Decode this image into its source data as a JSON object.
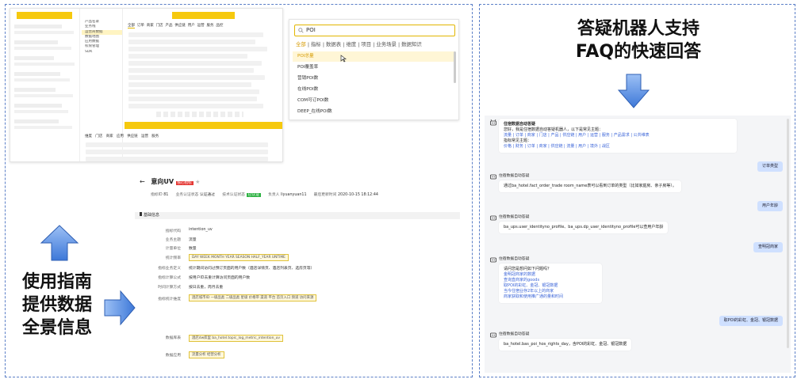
{
  "left_text": [
    "使用指南",
    "提供数据",
    "全景信息"
  ],
  "right_text": [
    "答疑机器人支持",
    "FAQ的快速回答"
  ],
  "nav_screenshot": {
    "tabs": [
      "全部",
      "订单",
      "商家",
      "门店",
      "产品",
      "供应链",
      "用户",
      "运营",
      "服务",
      "品控"
    ],
    "menu": [
      "产品名录",
      "业务线",
      "运营商数据",
      "数据地图",
      "应用数据",
      "权限管理",
      "SDK"
    ],
    "bottom_tabs": [
      "维度",
      "门店",
      "商家",
      "应用",
      "供应链",
      "运营",
      "服务"
    ]
  },
  "search_screenshot": {
    "query": "POI",
    "tabs": [
      "全部",
      "指标",
      "数据表",
      "维度",
      "项目",
      "业务场景",
      "数据知识"
    ],
    "results": [
      "POI总量",
      "POI覆盖率",
      "营销POI数",
      "在线POI数",
      "COM可订POI数",
      "DEEP_在线POI数"
    ]
  },
  "detail_screenshot": {
    "title": "意向UV",
    "badge": "核心指标",
    "meta": [
      {
        "label": "指标ID",
        "value": "81"
      },
      {
        "label": "业务认证状态",
        "value": "认证通过"
      },
      {
        "label": "技术认证状态",
        "value": "已认证"
      },
      {
        "label": "负责人",
        "value": "liyuanyuan11"
      },
      {
        "label": "最后更新时间",
        "value": "2020-10-15 18:12:44"
      }
    ],
    "section": "基础信息",
    "rows": [
      {
        "label": "指标代码",
        "value": "intention_uv"
      },
      {
        "label": "业务主题",
        "value": "流量"
      },
      {
        "label": "计量单位",
        "value": "数量"
      },
      {
        "label": "统计频率",
        "value": "DAY  WEEK  MONTH  YEAR  SEASON  HALF_YEAR  UNTIME"
      },
      {
        "label": "指标业务定义",
        "value": "统计期间访问过预订页面的用户数（酒店详情页、酒店列表页、选房页等）"
      },
      {
        "label": "指标计算公式",
        "value": "按用户ID去重计算访问页面的用户数"
      },
      {
        "label": "时间计算方式",
        "value": "按日去重，周月去重"
      },
      {
        "label": "指标统计维度",
        "value": "酒店城市ID  一级品类  二级品类  星级  价格带  渠道  平台  首页入口  频道  访问来源"
      },
      {
        "label": "数据库表",
        "value": "酒店dw库里 ba_hotel.topic_log_metric_intention_uv"
      },
      {
        "label": "数据应用",
        "value": "流量分析  经营分析"
      }
    ]
  },
  "chat_screenshot": {
    "bot_name": "住宿数据自动答疑",
    "intro": "您好，我是住宿数据自动答疑机器人，以下是常见主题：",
    "topics1": "流量 | 订单 | 商家 | 门店 | 产品 | 供应链 | 用户 | 运营 | 服务 | 产品需求 | 公共维表",
    "topics2_label": "指标常见主题：",
    "topics2": "价格 | 财务 | 订单 | 商家 | 供应链 | 流量 | 用户 | 境外 | 战区",
    "user_q1": "订单类型",
    "answer1": "通过ba_hotel.fact_order_trade room_name表可以看到订单的类型（比如家庭房、亲子房等）。",
    "user_q2": "用户年龄",
    "answer2": "ba_ups.user_identityno_profile、ba_ups.dp_user_identityno_profile可以查用户年龄",
    "user_q3": "查明冠商家",
    "answer3_title": "请问您是想问如下问题吗？",
    "answer3_items": [
      "金明冠商家的数据",
      "查询直商家的goods",
      "取POI的彩虹、金冠、银冠数据",
      "当今住宿业存2年以上的商家",
      "商家获取和使用推广通的量和时间"
    ],
    "user_q4": "取POI的彩虹、金冠、银冠数据",
    "answer4": "ba_hotel.bas_poi_hos_rights_day，含POI的彩虹、金冠、银冠数据"
  },
  "colors": {
    "accent": "#f6c90e",
    "arrow": "#4a86e8",
    "border": "#5b7fc7"
  }
}
